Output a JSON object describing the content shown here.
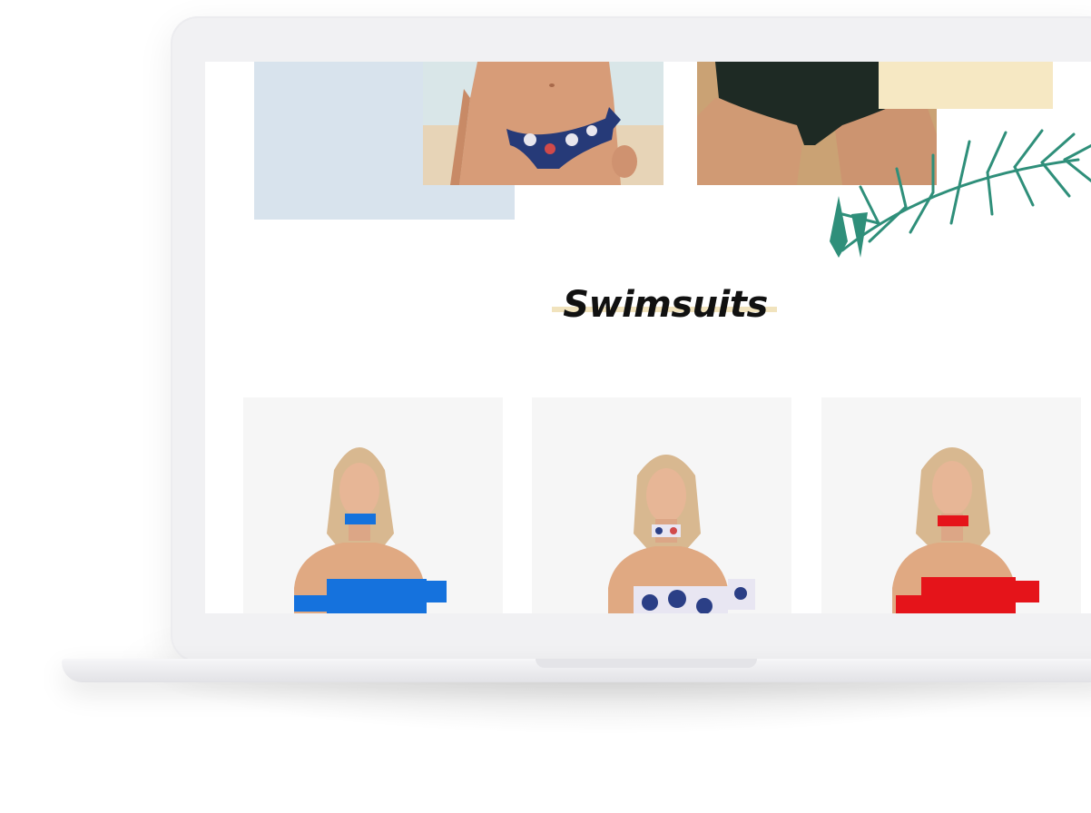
{
  "section": {
    "title": "Swimsuits"
  },
  "colors": {
    "banner_blue": "#d8e3ed",
    "banner_yellow": "#f6e8c3",
    "heading_underline": "#f1e3bd",
    "palm_green": "#2f8f7a",
    "card_bg": "#f6f6f6",
    "swimsuit_blue": "#1572dd",
    "swimsuit_red": "#e5141a"
  },
  "icons": {
    "decoration": "palm-leaf-icon"
  },
  "products": [
    {
      "style": "solid",
      "color": "blue"
    },
    {
      "style": "print",
      "color": "floral"
    },
    {
      "style": "solid",
      "color": "red"
    }
  ]
}
